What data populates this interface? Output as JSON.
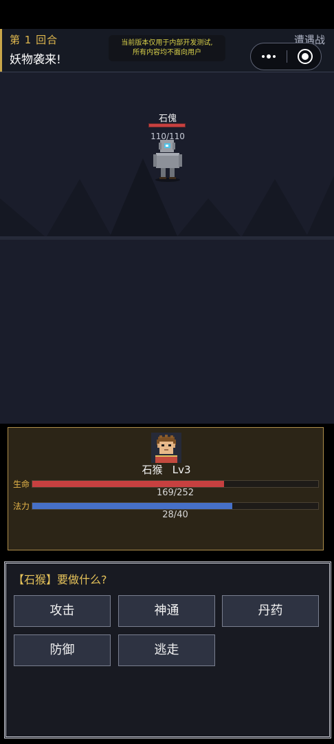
{
  "header": {
    "round_label": "第 1 回合",
    "battle_message": "妖物袭来!",
    "dev_notice_line1": "当前版本仅用于内部开发测试,",
    "dev_notice_line2": "所有内容均不面向用户",
    "battle_type": "遭遇战"
  },
  "enemy": {
    "name": "石傀",
    "hp_text": "110/110",
    "hp_fraction": 1.0
  },
  "hero": {
    "name": "石猴",
    "level": "Lv3",
    "hp_label": "生命",
    "hp_text": "169/252",
    "hp_fraction": 0.6706,
    "mp_label": "法力",
    "mp_text": "28/40",
    "mp_fraction": 0.7
  },
  "actions": {
    "prompt": "【石猴】要做什么?",
    "buttons": [
      "攻击",
      "神通",
      "丹药",
      "防御",
      "逃走"
    ]
  },
  "colors": {
    "hp_bar": "#c74040",
    "mp_bar": "#4670c8",
    "gold_accent": "#e0b84e",
    "scene_bg": "#1a1d2b"
  },
  "icons": {
    "menu": "more-dots-icon",
    "close": "target-circle-icon"
  }
}
